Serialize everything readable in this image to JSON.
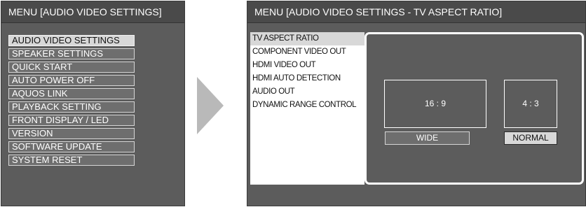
{
  "left_panel": {
    "title": "MENU   [AUDIO VIDEO SETTINGS]",
    "items": [
      {
        "label": "AUDIO VIDEO SETTINGS"
      },
      {
        "label": "SPEAKER SETTINGS"
      },
      {
        "label": "QUICK START"
      },
      {
        "label": "AUTO POWER OFF"
      },
      {
        "label": "AQUOS LINK"
      },
      {
        "label": "PLAYBACK SETTING"
      },
      {
        "label": "FRONT DISPLAY / LED"
      },
      {
        "label": "VERSION"
      },
      {
        "label": "SOFTWARE UPDATE"
      },
      {
        "label": "SYSTEM RESET"
      }
    ],
    "selected_index": 0
  },
  "arrow": {
    "icon": "arrow-right-icon",
    "color": "#b9b9b9"
  },
  "right_panel": {
    "title": "MENU   [AUDIO VIDEO SETTINGS - TV ASPECT RATIO]",
    "items": [
      {
        "label": "TV ASPECT RATIO"
      },
      {
        "label": "COMPONENT VIDEO OUT"
      },
      {
        "label": "HDMI VIDEO OUT"
      },
      {
        "label": "HDMI AUTO DETECTION"
      },
      {
        "label": "AUDIO OUT"
      },
      {
        "label": "DYNAMIC RANGE CONTROL"
      }
    ],
    "selected_index": 0,
    "options": {
      "wide": {
        "ratio": "16 : 9",
        "label": "WIDE"
      },
      "normal": {
        "ratio": "4 : 3",
        "label": "NORMAL"
      },
      "selected": "normal"
    }
  }
}
